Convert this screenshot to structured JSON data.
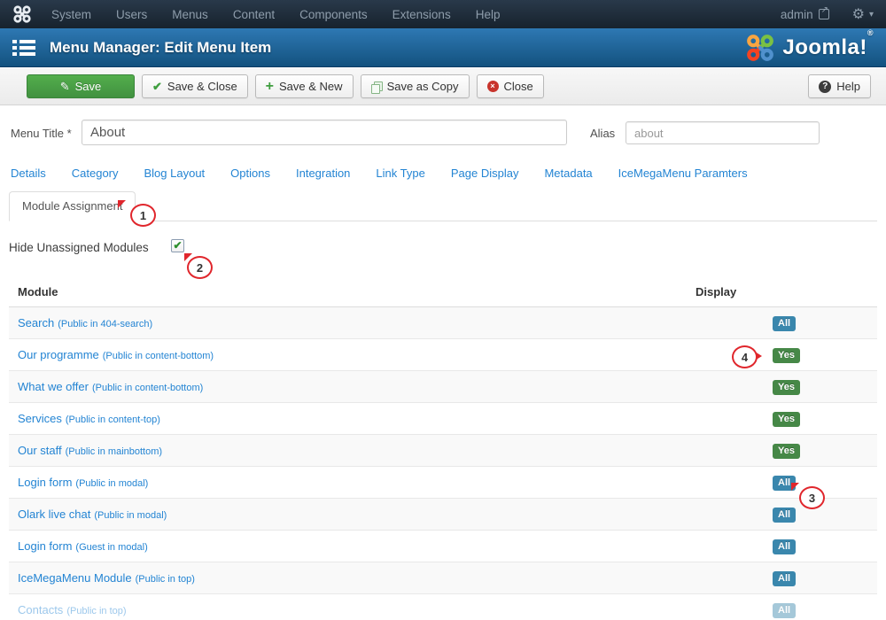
{
  "topbar": {
    "menu_items": [
      "System",
      "Users",
      "Menus",
      "Content",
      "Components",
      "Extensions",
      "Help"
    ],
    "user_label": "admin"
  },
  "header": {
    "title": "Menu Manager: Edit Menu Item",
    "brand": "Joomla!",
    "brand_reg": "®"
  },
  "toolbar": {
    "buttons": [
      {
        "label": "Save",
        "icon": "save-icon",
        "variant": "success"
      },
      {
        "label": "Save & Close",
        "icon": "check-icon",
        "variant": "default"
      },
      {
        "label": "Save & New",
        "icon": "plus-icon",
        "variant": "default"
      },
      {
        "label": "Save as Copy",
        "icon": "copy-icon",
        "variant": "default"
      },
      {
        "label": "Close",
        "icon": "cancel-icon",
        "variant": "default"
      }
    ],
    "help_label": "Help"
  },
  "form": {
    "menu_title_label": "Menu Title *",
    "menu_title_value": "About",
    "alias_label": "Alias",
    "alias_value": "about"
  },
  "tabs": [
    "Details",
    "Category",
    "Blog Layout",
    "Options",
    "Integration",
    "Link Type",
    "Page Display",
    "Metadata",
    "IceMegaMenu Paramters"
  ],
  "active_tab": "Module Assignment",
  "module_panel": {
    "hide_unassigned_label": "Hide Unassigned Modules",
    "checkbox_checked": true,
    "columns": [
      "Module",
      "Display"
    ],
    "rows": [
      {
        "name": "Search",
        "note": "(Public in 404-search)",
        "display": "All",
        "badge": "info",
        "faded": false
      },
      {
        "name": "Our programme",
        "note": "(Public in content-bottom)",
        "display": "Yes",
        "badge": "success",
        "faded": false
      },
      {
        "name": "What we offer",
        "note": "(Public in content-bottom)",
        "display": "Yes",
        "badge": "success",
        "faded": false
      },
      {
        "name": "Services",
        "note": "(Public in content-top)",
        "display": "Yes",
        "badge": "success",
        "faded": false
      },
      {
        "name": "Our staff",
        "note": "(Public in mainbottom)",
        "display": "Yes",
        "badge": "success",
        "faded": false
      },
      {
        "name": "Login form",
        "note": "(Public in modal)",
        "display": "All",
        "badge": "info",
        "faded": false
      },
      {
        "name": "Olark live chat",
        "note": "(Public in modal)",
        "display": "All",
        "badge": "info",
        "faded": false
      },
      {
        "name": "Login form",
        "note": "(Guest in modal)",
        "display": "All",
        "badge": "info",
        "faded": false
      },
      {
        "name": "IceMegaMenu Module",
        "note": "(Public in top)",
        "display": "All",
        "badge": "info",
        "faded": false
      },
      {
        "name": "Contacts",
        "note": "(Public in top)",
        "display": "All",
        "badge": "info",
        "faded": true
      }
    ]
  },
  "badge_colors": {
    "info": "#3a87ad",
    "success": "#468847"
  },
  "annotations": [
    {
      "number": "1"
    },
    {
      "number": "2"
    },
    {
      "number": "3"
    },
    {
      "number": "4"
    }
  ]
}
